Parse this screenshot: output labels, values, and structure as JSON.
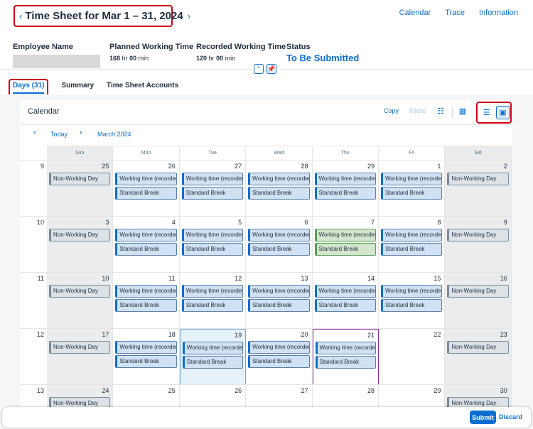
{
  "header": {
    "title": "Time Sheet for Mar 1 – 31, 2024",
    "prev_icon": "‹",
    "next_icon": "›",
    "links": [
      "Calendar",
      "Trace",
      "Information"
    ]
  },
  "attributes": {
    "employee_label": "Employee Name",
    "planned_label": "Planned Working Time",
    "planned_hr": "168",
    "planned_min": "00",
    "recorded_label": "Recorded Working Time",
    "recorded_hr": "120",
    "recorded_min": "00",
    "unit_hr": "hr",
    "unit_min": "min",
    "status_label": "Status",
    "status_value": "To Be Submitted"
  },
  "tabs": [
    "Days (31)",
    "Summary",
    "Time Sheet Accounts"
  ],
  "calendar": {
    "title": "Calendar",
    "copy": "Copy",
    "paste": "Paste",
    "today": "Today",
    "month": "March 2024",
    "weekdays": [
      "Sun",
      "Mon",
      "Tue",
      "Wed",
      "Thu",
      "Fri",
      "Sat"
    ],
    "weeks": [
      {
        "num": "9",
        "days": [
          {
            "d": "25",
            "events": [
              "Non-Working Day"
            ],
            "kind": "nw",
            "wkend": true
          },
          {
            "d": "26",
            "events": [
              "Working time (recorded)",
              "Standard Break"
            ]
          },
          {
            "d": "27",
            "events": [
              "Working time (recorded)",
              "Standard Break"
            ]
          },
          {
            "d": "28",
            "events": [
              "Working time (recorded)",
              "Standard Break"
            ]
          },
          {
            "d": "29",
            "events": [
              "Working time (recorded)",
              "Standard Break"
            ]
          },
          {
            "d": "1",
            "events": [
              "Working time (recorded)",
              "Standard Break"
            ]
          },
          {
            "d": "2",
            "events": [
              "Non-Working Day"
            ],
            "kind": "nw",
            "wkend": true
          }
        ]
      },
      {
        "num": "10",
        "days": [
          {
            "d": "3",
            "events": [
              "Non-Working Day"
            ],
            "kind": "nw",
            "wkend": true
          },
          {
            "d": "4",
            "events": [
              "Working time (recorded)",
              "Standard Break"
            ]
          },
          {
            "d": "5",
            "events": [
              "Working time (recorded)",
              "Standard Break"
            ]
          },
          {
            "d": "6",
            "events": [
              "Working time (recorded)",
              "Standard Break"
            ]
          },
          {
            "d": "7",
            "events": [
              "Working time (recorded)",
              "Standard Break"
            ],
            "kind": "green"
          },
          {
            "d": "8",
            "events": [
              "Working time (recorded)",
              "Standard Break"
            ]
          },
          {
            "d": "9",
            "events": [
              "Non-Working Day"
            ],
            "kind": "nw",
            "wkend": true
          }
        ]
      },
      {
        "num": "11",
        "days": [
          {
            "d": "10",
            "events": [
              "Non-Working Day"
            ],
            "kind": "nw",
            "wkend": true
          },
          {
            "d": "11",
            "events": [
              "Working time (recorded)",
              "Standard Break"
            ]
          },
          {
            "d": "12",
            "events": [
              "Working time (recorded)",
              "Standard Break"
            ]
          },
          {
            "d": "13",
            "events": [
              "Working time (recorded)",
              "Standard Break"
            ]
          },
          {
            "d": "14",
            "events": [
              "Working time (recorded)",
              "Standard Break"
            ]
          },
          {
            "d": "15",
            "events": [
              "Working time (recorded)",
              "Standard Break"
            ]
          },
          {
            "d": "16",
            "events": [
              "Non-Working Day"
            ],
            "kind": "nw",
            "wkend": true
          }
        ]
      },
      {
        "num": "12",
        "days": [
          {
            "d": "17",
            "events": [
              "Non-Working Day"
            ],
            "kind": "nw",
            "wkend": true
          },
          {
            "d": "18",
            "events": [
              "Working time (recorded)",
              "Standard Break"
            ]
          },
          {
            "d": "19",
            "events": [
              "Working time (recorded)",
              "Standard Break"
            ],
            "state": "today"
          },
          {
            "d": "20",
            "events": [
              "Working time (recorded)",
              "Standard Break"
            ]
          },
          {
            "d": "21",
            "events": [
              "Working time (recorded)",
              "Standard Break"
            ],
            "state": "sel"
          },
          {
            "d": "22",
            "events": []
          },
          {
            "d": "23",
            "events": [
              "Non-Working Day"
            ],
            "kind": "nw",
            "wkend": true
          }
        ]
      },
      {
        "num": "13",
        "days": [
          {
            "d": "24",
            "events": [
              "Non-Working Day"
            ],
            "kind": "nw",
            "wkend": true
          },
          {
            "d": "25",
            "events": []
          },
          {
            "d": "26",
            "events": []
          },
          {
            "d": "27",
            "events": []
          },
          {
            "d": "28",
            "events": []
          },
          {
            "d": "29",
            "events": []
          },
          {
            "d": "30",
            "events": [
              "Non-Working Day"
            ],
            "kind": "nw",
            "wkend": true
          }
        ]
      }
    ]
  },
  "footer": {
    "submit": "Submit",
    "discard": "Discard"
  },
  "colors": {
    "accent": "#0a6ed1",
    "highlight_border": "#d0021b",
    "selected_day_border": "#8f2ca0"
  }
}
